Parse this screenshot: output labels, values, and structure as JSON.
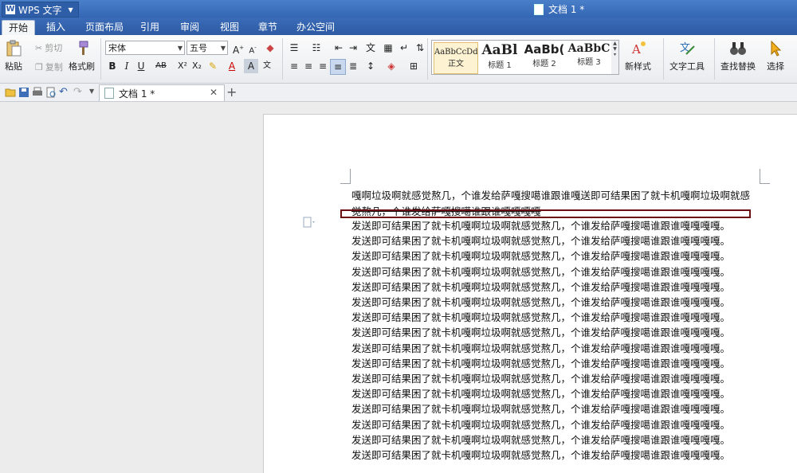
{
  "app": {
    "name": "WPS 文字",
    "window_title": "文档 1 *"
  },
  "tabs": [
    {
      "label": "开始"
    },
    {
      "label": "插入"
    },
    {
      "label": "页面布局"
    },
    {
      "label": "引用"
    },
    {
      "label": "审阅"
    },
    {
      "label": "视图"
    },
    {
      "label": "章节"
    },
    {
      "label": "办公空间"
    }
  ],
  "ribbon": {
    "clipboard": {
      "paste": "粘贴",
      "cut": "剪切",
      "copy": "复制",
      "format_painter": "格式刷"
    },
    "font": {
      "family": "宋体",
      "size": "五号"
    },
    "styles": [
      {
        "sample": "AaBbCcDd",
        "name": "正文"
      },
      {
        "sample": "AaBl",
        "name": "标题 1"
      },
      {
        "sample": "AaBb(",
        "name": "标题 2"
      },
      {
        "sample": "AaBbC",
        "name": "标题 3"
      }
    ],
    "new_style": "新样式",
    "text_tools": "文字工具",
    "find_replace": "查找替换",
    "select": "选择"
  },
  "document_tab": {
    "title": "文档 1 *"
  },
  "document": {
    "paragraph1_line1": "嘎啊垃圾啊就感觉熬几，个谁发给萨嘎搜噶谁跟谁嘎送即可结果困了就卡机嘎啊垃圾啊就感",
    "paragraph1_line2": "觉熬几，个谁发给萨嘎搜噶谁跟谁嘎嘎嘎嘎",
    "repeated_line": "发送即可结果困了就卡机嘎啊垃圾啊就感觉熬几，个谁发给萨嘎搜噶谁跟谁嘎嘎嘎嘎。",
    "lines": [
      "发送即可结果困了就卡机嘎啊垃圾啊就感觉熬几，个谁发给萨嘎搜噶谁跟谁嘎嘎嘎嘎。",
      "发送即可结果困了就卡机嘎啊垃圾啊就感觉熬几，个谁发给萨嘎搜噶谁跟谁嘎嘎嘎嘎。",
      "发送即可结果困了就卡机嘎啊垃圾啊就感觉熬几，个谁发给萨嘎搜噶谁跟谁嘎嘎嘎嘎。",
      "发送即可结果困了就卡机嘎啊垃圾啊就感觉熬几，个谁发给萨嘎搜噶谁跟谁嘎嘎嘎嘎。",
      "发送即可结果困了就卡机嘎啊垃圾啊就感觉熬几，个谁发给萨嘎搜噶谁跟谁嘎嘎嘎嘎。",
      "发送即可结果困了就卡机嘎啊垃圾啊就感觉熬几，个谁发给萨嘎搜噶谁跟谁嘎嘎嘎嘎。",
      "发送即可结果困了就卡机嘎啊垃圾啊就感觉熬几，个谁发给萨嘎搜噶谁跟谁嘎嘎嘎嘎。",
      "发送即可结果困了就卡机嘎啊垃圾啊就感觉熬几，个谁发给萨嘎搜噶谁跟谁嘎嘎嘎嘎。",
      "发送即可结果困了就卡机嘎啊垃圾啊就感觉熬几，个谁发给萨嘎搜噶谁跟谁嘎嘎嘎嘎。",
      "发送即可结果困了就卡机嘎啊垃圾啊就感觉熬几，个谁发给萨嘎搜噶谁跟谁嘎嘎嘎嘎。",
      "发送即可结果困了就卡机嘎啊垃圾啊就感觉熬几，个谁发给萨嘎搜噶谁跟谁嘎嘎嘎嘎。",
      "发送即可结果困了就卡机嘎啊垃圾啊就感觉熬几，个谁发给萨嘎搜噶谁跟谁嘎嘎嘎嘎。",
      "发送即可结果困了就卡机嘎啊垃圾啊就感觉熬几，个谁发给萨嘎搜噶谁跟谁嘎嘎嘎嘎。",
      "发送即可结果困了就卡机嘎啊垃圾啊就感觉熬几，个谁发给萨嘎搜噶谁跟谁嘎嘎嘎嘎。",
      "发送即可结果困了就卡机嘎啊垃圾啊就感觉熬几，个谁发给萨嘎搜噶谁跟谁嘎嘎嘎嘎。",
      "发送即可结果困了就卡机嘎啊垃圾啊就感觉熬几，个谁发给萨嘎搜噶谁跟谁嘎嘎嘎嘎。"
    ]
  },
  "colors": {
    "titlebar": "#3466b4",
    "highlight_border": "#6b0f12"
  }
}
